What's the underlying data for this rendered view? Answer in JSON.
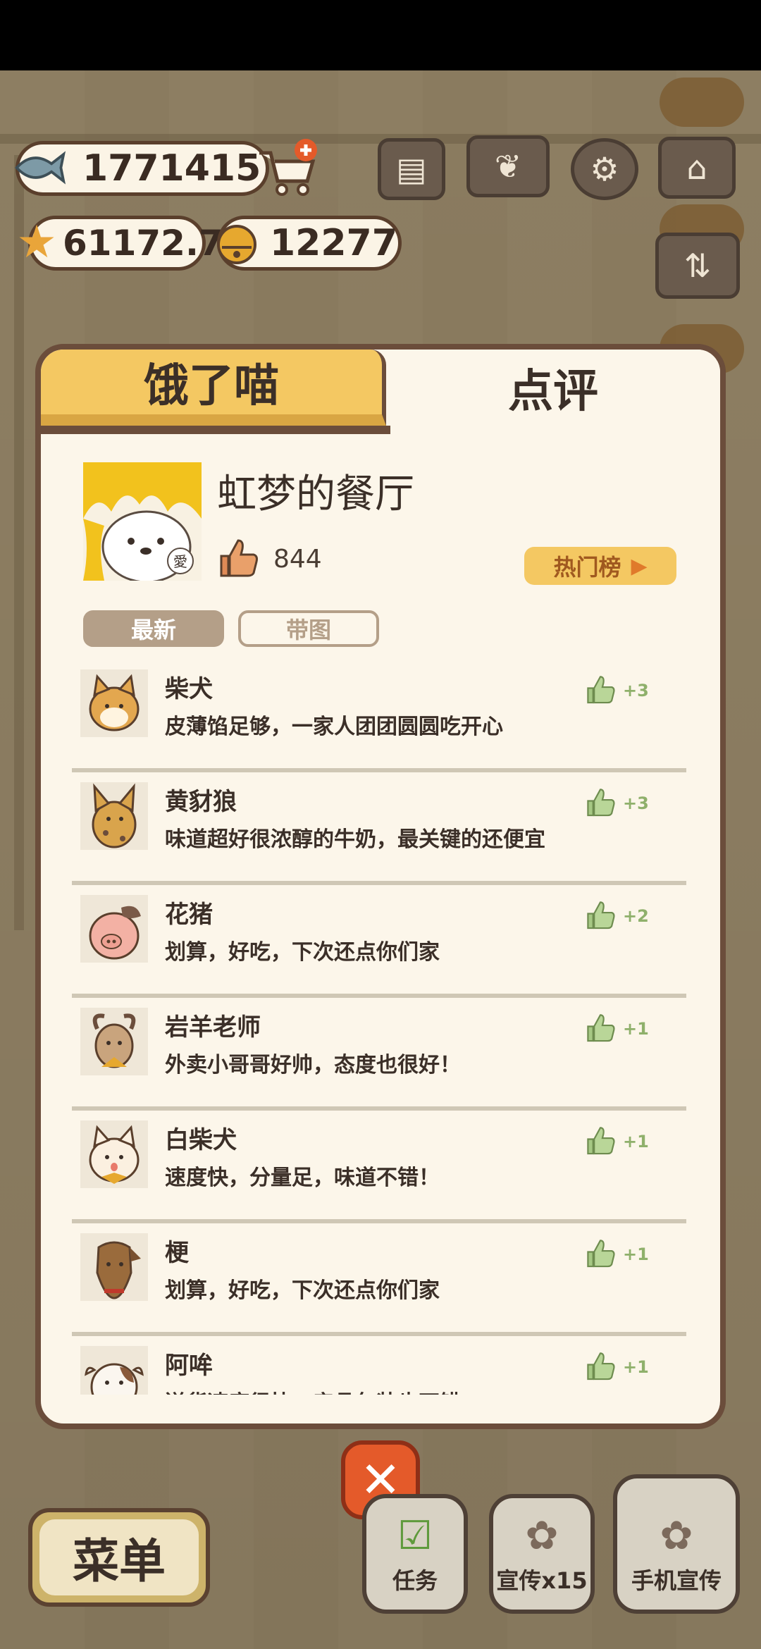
{
  "hud": {
    "fish": "1771415",
    "stars": "61172.7",
    "bells": "12277"
  },
  "panel": {
    "tab_left": "饿了喵",
    "tab_right": "点评",
    "restaurant_name": "虹梦的餐厅",
    "likes": "844",
    "hot_list": "热门榜",
    "filter_latest": "最新",
    "filter_with_pics": "带图",
    "avatar_badge": "愛"
  },
  "reviews": [
    {
      "name": "柴犬",
      "text": "皮薄馅足够，一家人团团圆圆吃开心",
      "likes": "+3"
    },
    {
      "name": "黄豺狼",
      "text": "味道超好很浓醇的牛奶，最关键的还便宜",
      "likes": "+3"
    },
    {
      "name": "花猪",
      "text": "划算，好吃，下次还点你们家",
      "likes": "+2"
    },
    {
      "name": "岩羊老师",
      "text": "外卖小哥哥好帅，态度也很好！",
      "likes": "+1"
    },
    {
      "name": "白柴犬",
      "text": "速度快，分量足，味道不错！",
      "likes": "+1"
    },
    {
      "name": "梗",
      "text": "划算，好吃，下次还点你们家",
      "likes": "+1"
    },
    {
      "name": "阿哞",
      "text": "送货速度很快，产品包装也不错",
      "likes": "+1"
    }
  ],
  "bottom": {
    "menu": "菜单",
    "tasks": "任务",
    "promote": "宣传x15",
    "phone_promote": "手机宣传"
  },
  "colors": {
    "tab_active": "#f4c862",
    "panel_bg": "#fcf6ea",
    "border": "#6b4d3b",
    "like_green": "#8fb06b",
    "close_red": "#e45a2a"
  }
}
